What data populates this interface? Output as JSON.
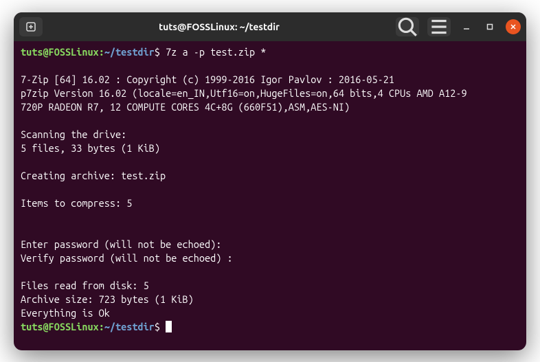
{
  "titlebar": {
    "title": "tuts@FOSSLinux: ~/testdir"
  },
  "prompt": {
    "user_host": "tuts@FOSSLinux",
    "colon": ":",
    "path": "~/testdir",
    "dollar": "$"
  },
  "command": "7z a -p test.zip *",
  "output": {
    "l1": "7-Zip [64] 16.02 : Copyright (c) 1999-2016 Igor Pavlov : 2016-05-21",
    "l2": "p7zip Version 16.02 (locale=en_IN,Utf16=on,HugeFiles=on,64 bits,4 CPUs AMD A12-9",
    "l3": "720P RADEON R7, 12 COMPUTE CORES 4C+8G (660F51),ASM,AES-NI)",
    "l4": "Scanning the drive:",
    "l5": "5 files, 33 bytes (1 KiB)",
    "l6": "Creating archive: test.zip",
    "l7": "Items to compress: 5",
    "l8": "Enter password (will not be echoed):",
    "l9": "Verify password (will not be echoed) :",
    "l10": "Files read from disk: 5",
    "l11": "Archive size: 723 bytes (1 KiB)",
    "l12": "Everything is Ok"
  }
}
